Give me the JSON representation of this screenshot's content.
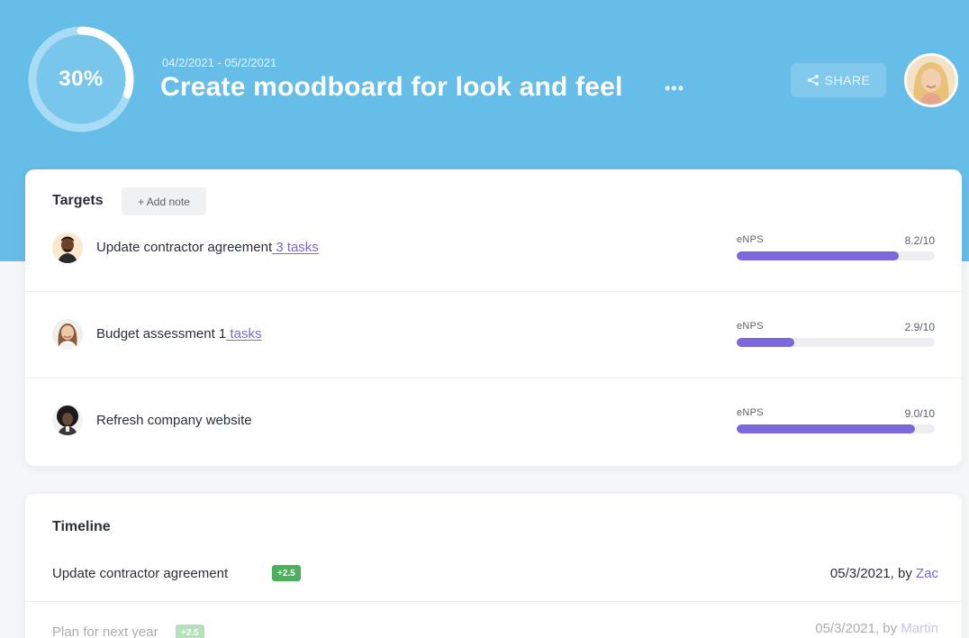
{
  "header": {
    "progress_label": "30%",
    "progress_fraction": 0.3,
    "date_range": "04/2/2021 - 05/2/2021",
    "title": "Create moodboard for look and feel",
    "more_glyph": "•••",
    "share_label": "SHARE",
    "share_icon": "share-icon",
    "colors": {
      "hero": "#66bde8",
      "accent_bar": "#7a68dd",
      "link": "#7b68c9",
      "badge": "#4cb05a"
    }
  },
  "targets": {
    "heading": "Targets",
    "add_note_label": "+ Add note",
    "items": [
      {
        "label": "Update contractor agreement",
        "tasks_link": " 3 tasks",
        "metric_name": "eNPS",
        "metric_value": "8.2/10",
        "score": 8.2
      },
      {
        "label": "Budget assessment 1",
        "tasks_link": " tasks",
        "metric_name": "eNPS",
        "metric_value": "2.9/10",
        "score": 2.9
      },
      {
        "label": "Refresh company website",
        "tasks_link": "",
        "metric_name": "eNPS",
        "metric_value": "9.0/10",
        "score": 9.0
      }
    ]
  },
  "timeline": {
    "heading": "Timeline",
    "items": [
      {
        "label": "Update contractor agreement",
        "badge": "+2.5",
        "date": "05/3/2021, by ",
        "author": "Zac"
      },
      {
        "label": "Plan for next year",
        "badge": "+2.5",
        "date": "05/3/2021, by ",
        "author": "Martin"
      }
    ]
  }
}
